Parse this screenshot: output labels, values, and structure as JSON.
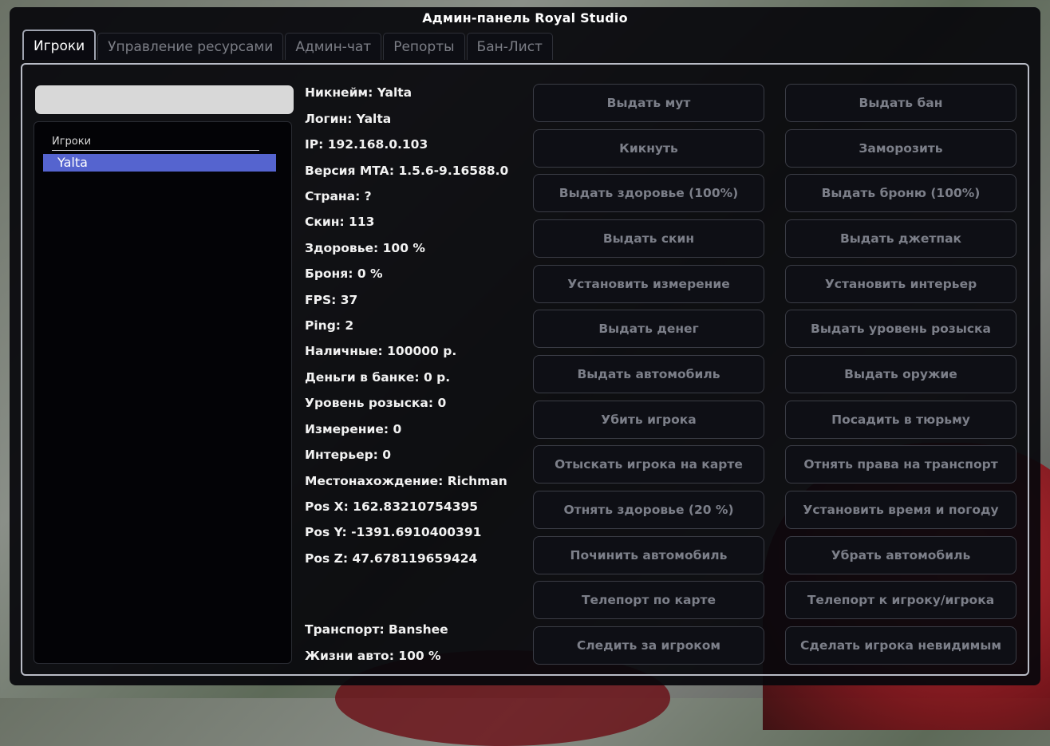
{
  "window": {
    "title": "Админ-панель Royal Studio"
  },
  "tabs": [
    {
      "label": "Игроки",
      "active": true
    },
    {
      "label": "Управление ресурсами",
      "active": false
    },
    {
      "label": "Админ-чат",
      "active": false
    },
    {
      "label": "Репорты",
      "active": false
    },
    {
      "label": "Бан-Лист",
      "active": false
    }
  ],
  "search": {
    "value": "",
    "placeholder": ""
  },
  "player_list": {
    "header": "Игроки",
    "items": [
      {
        "name": "Yalta",
        "selected": true
      }
    ]
  },
  "player_info": {
    "nickname": "Никнейм: Yalta",
    "login": "Логин: Yalta",
    "ip": "IP: 192.168.0.103",
    "mta_version": "Версия MTA: 1.5.6-9.16588.0",
    "country": "Страна: ?",
    "skin": "Скин: 113",
    "health": "Здоровье: 100 %",
    "armor": "Броня: 0 %",
    "fps": "FPS: 37",
    "ping": "Ping: 2",
    "cash": "Наличные: 100000 р.",
    "bank": "Деньги в банке: 0 р.",
    "wanted": "Уровень розыска: 0",
    "dimension": "Измерение: 0",
    "interior": "Интерьер: 0",
    "location": "Местонахождение: Richman",
    "pos_x": "Pos X: 162.83210754395",
    "pos_y": "Pos Y: -1391.6910400391",
    "pos_z": "Pos Z: 47.678119659424",
    "vehicle": "Транспорт: Banshee",
    "vehicle_health": "Жизни авто: 100 %"
  },
  "actions": {
    "left": [
      "Выдать мут",
      "Кикнуть",
      "Выдать здоровье (100%)",
      "Выдать скин",
      "Установить измерение",
      "Выдать денег",
      "Выдать автомобиль",
      "Убить игрока",
      "Отыскать игрока на карте",
      "Отнять здоровье (20 %)",
      "Починить автомобиль",
      "Телепорт по карте",
      "Следить за игроком"
    ],
    "right": [
      "Выдать бан",
      "Заморозить",
      "Выдать броню (100%)",
      "Выдать джетпак",
      "Установить интерьер",
      "Выдать уровень розыска",
      "Выдать оружие",
      "Посадить в тюрьму",
      "Отнять права на транспорт",
      "Установить время и погоду",
      "Убрать автомобиль",
      "Телепорт к игроку/игрока",
      "Сделать игрока невидимым"
    ]
  }
}
